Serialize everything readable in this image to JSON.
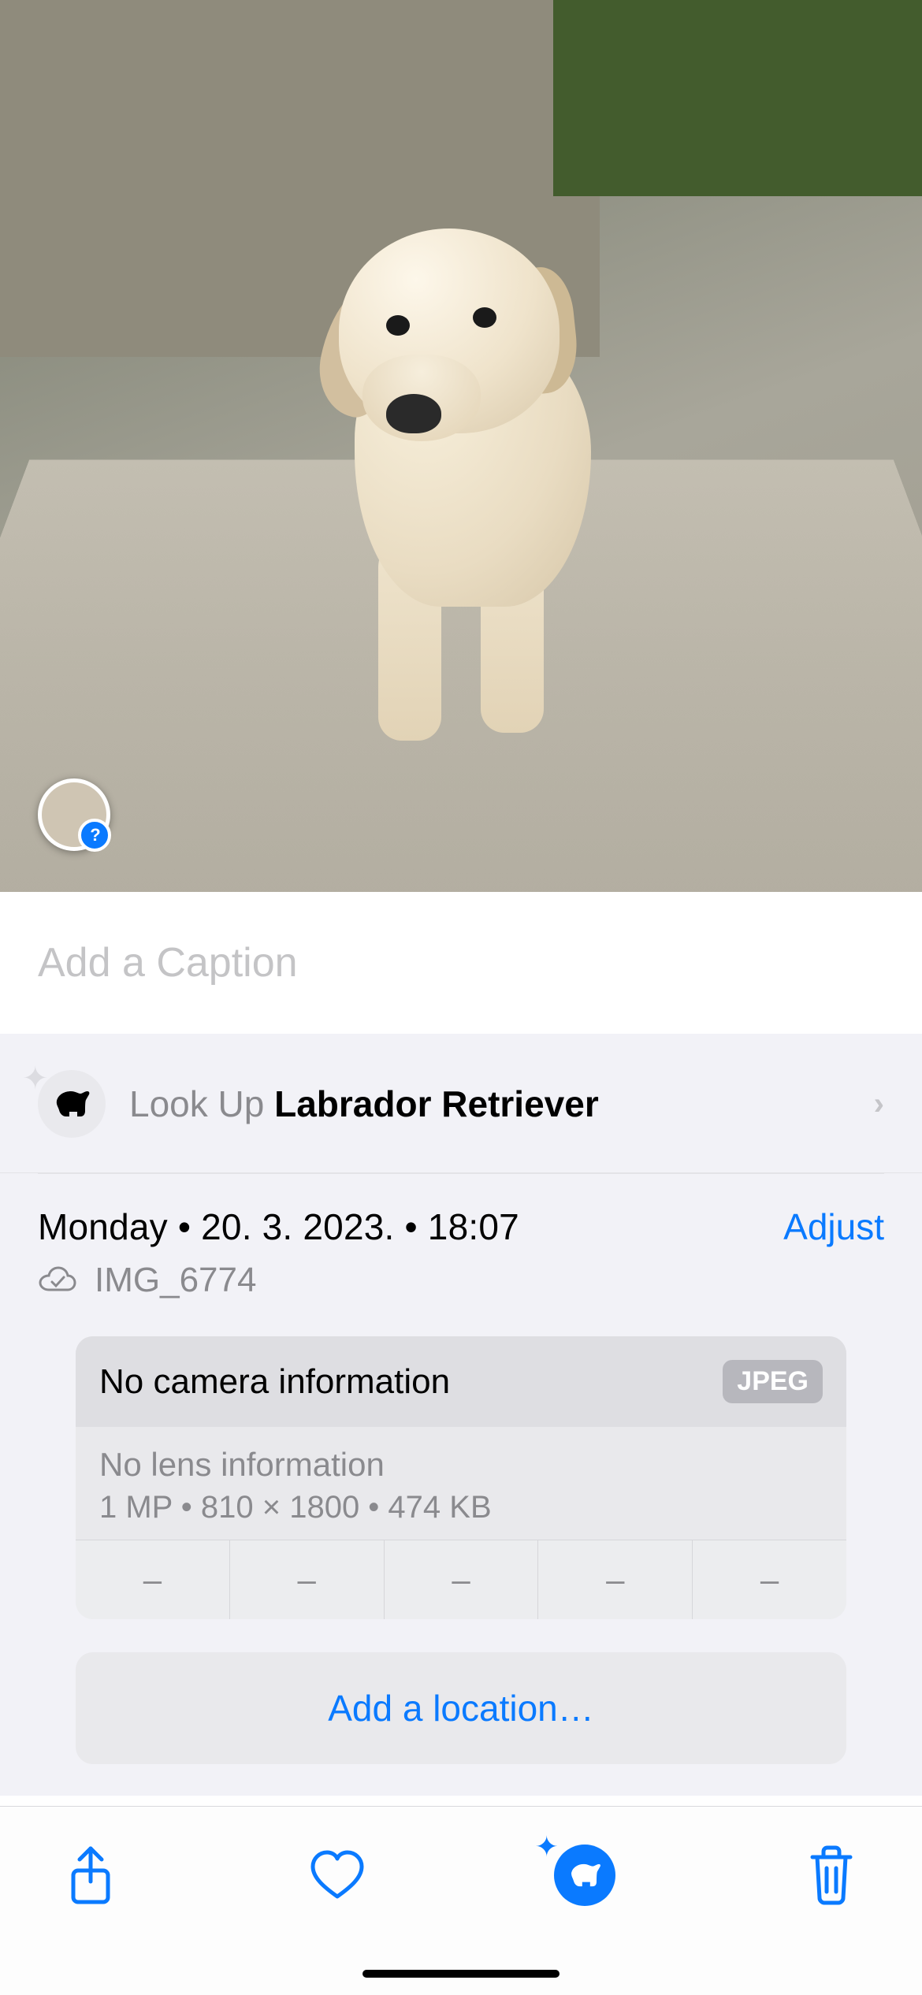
{
  "caption": {
    "placeholder": "Add a Caption",
    "value": ""
  },
  "lookup": {
    "prefix": "Look Up ",
    "subject": "Labrador Retriever"
  },
  "datetime": {
    "weekday": "Monday",
    "date": "20. 3. 2023.",
    "time": "18:07"
  },
  "adjust_label": "Adjust",
  "filename": "IMG_6774",
  "camera": {
    "camera_info": "No camera information",
    "format_badge": "JPEG",
    "lens_info": "No lens information",
    "megapixels": "1 MP",
    "dimensions": "810 × 1800",
    "filesize": "474 KB"
  },
  "exif_cells": [
    "–",
    "–",
    "–",
    "–",
    "–"
  ],
  "location_button": "Add a location…",
  "separator_dot": " • "
}
